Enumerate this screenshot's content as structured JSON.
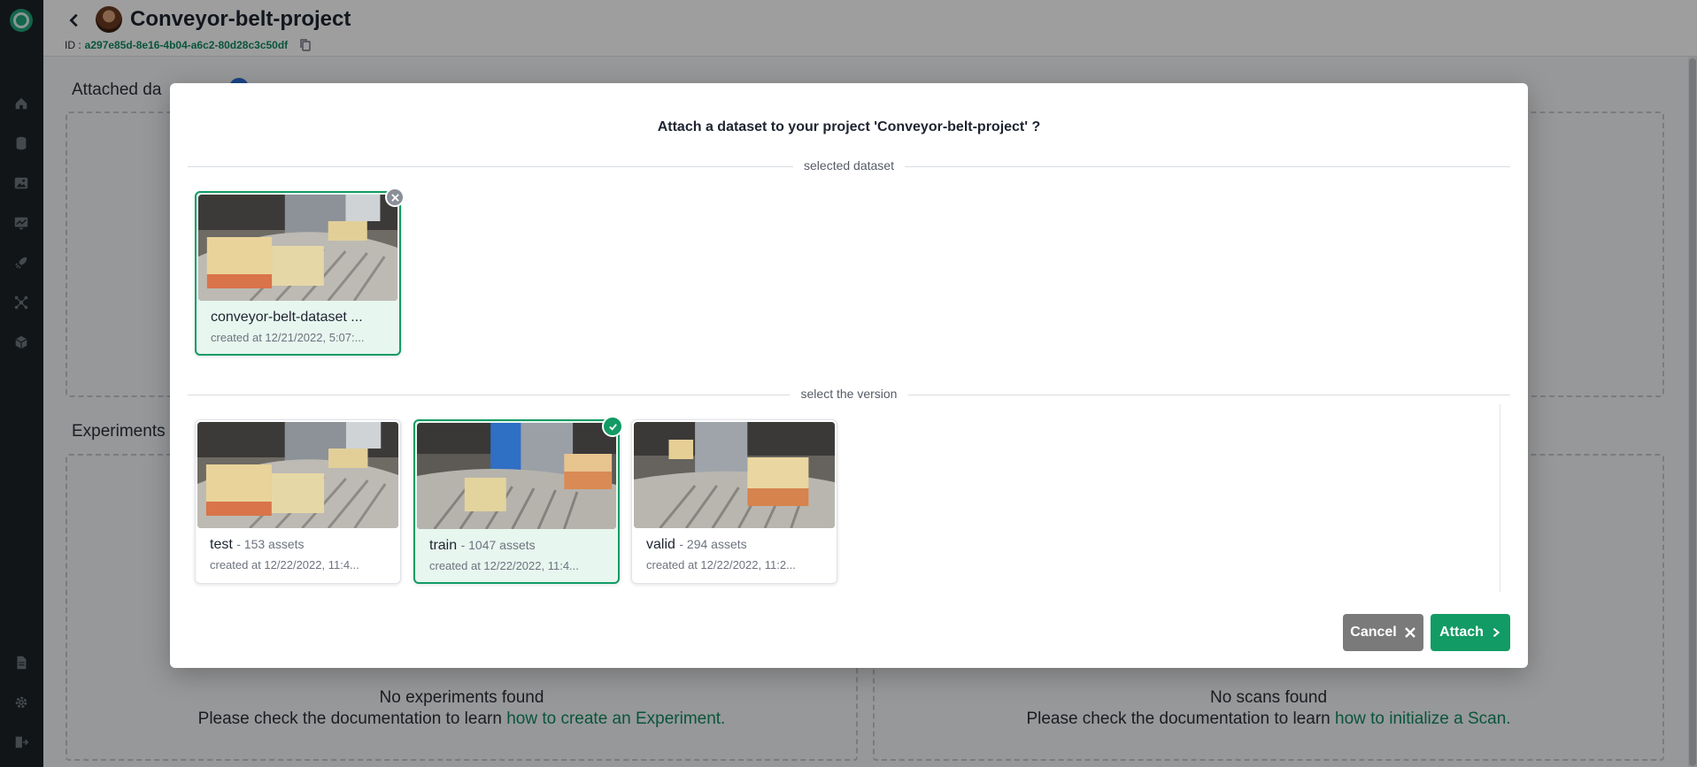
{
  "header": {
    "title": "Conveyor-belt-project",
    "id_label": "ID :",
    "id_value": "a297e85d-8e16-4b04-a6c2-80d28c3c50df"
  },
  "background": {
    "attached_datasets_title": "Attached da",
    "experiments_title": "Experiments",
    "experiments_empty": {
      "line1": "No experiments found",
      "line2": "Please check the documentation to learn",
      "link": "how to create an Experiment."
    },
    "scans_empty": {
      "line1": "No scans found",
      "line2": "Please check the documentation to learn",
      "link": "how to initialize a Scan."
    }
  },
  "sidebar": {
    "items": [
      "home-icon",
      "database-icon",
      "image-icon",
      "chart-icon",
      "rocket-icon",
      "network-icon",
      "box-icon"
    ],
    "bottom_items": [
      "document-icon",
      "gear-icon",
      "logout-icon"
    ]
  },
  "modal": {
    "title": "Attach a dataset to your project 'Conveyor-belt-project' ?",
    "selected_label": "selected dataset",
    "version_label": "select the version",
    "selected_dataset": {
      "name": "conveyor-belt-dataset ...",
      "date": "created at 12/21/2022, 5:07:..."
    },
    "versions": [
      {
        "name": "test",
        "assets": "- 153 assets",
        "date": "created at 12/22/2022, 11:4...",
        "selected": false
      },
      {
        "name": "train",
        "assets": "- 1047 assets",
        "date": "created at 12/22/2022, 11:4...",
        "selected": true
      },
      {
        "name": "valid",
        "assets": "- 294 assets",
        "date": "created at 12/22/2022, 11:2...",
        "selected": false
      }
    ],
    "cancel_label": "Cancel",
    "attach_label": "Attach"
  },
  "colors": {
    "accent": "#129b65",
    "sidebar": "#1d2326",
    "cancel": "#7a7a7a",
    "link": "#0f8a5f"
  }
}
